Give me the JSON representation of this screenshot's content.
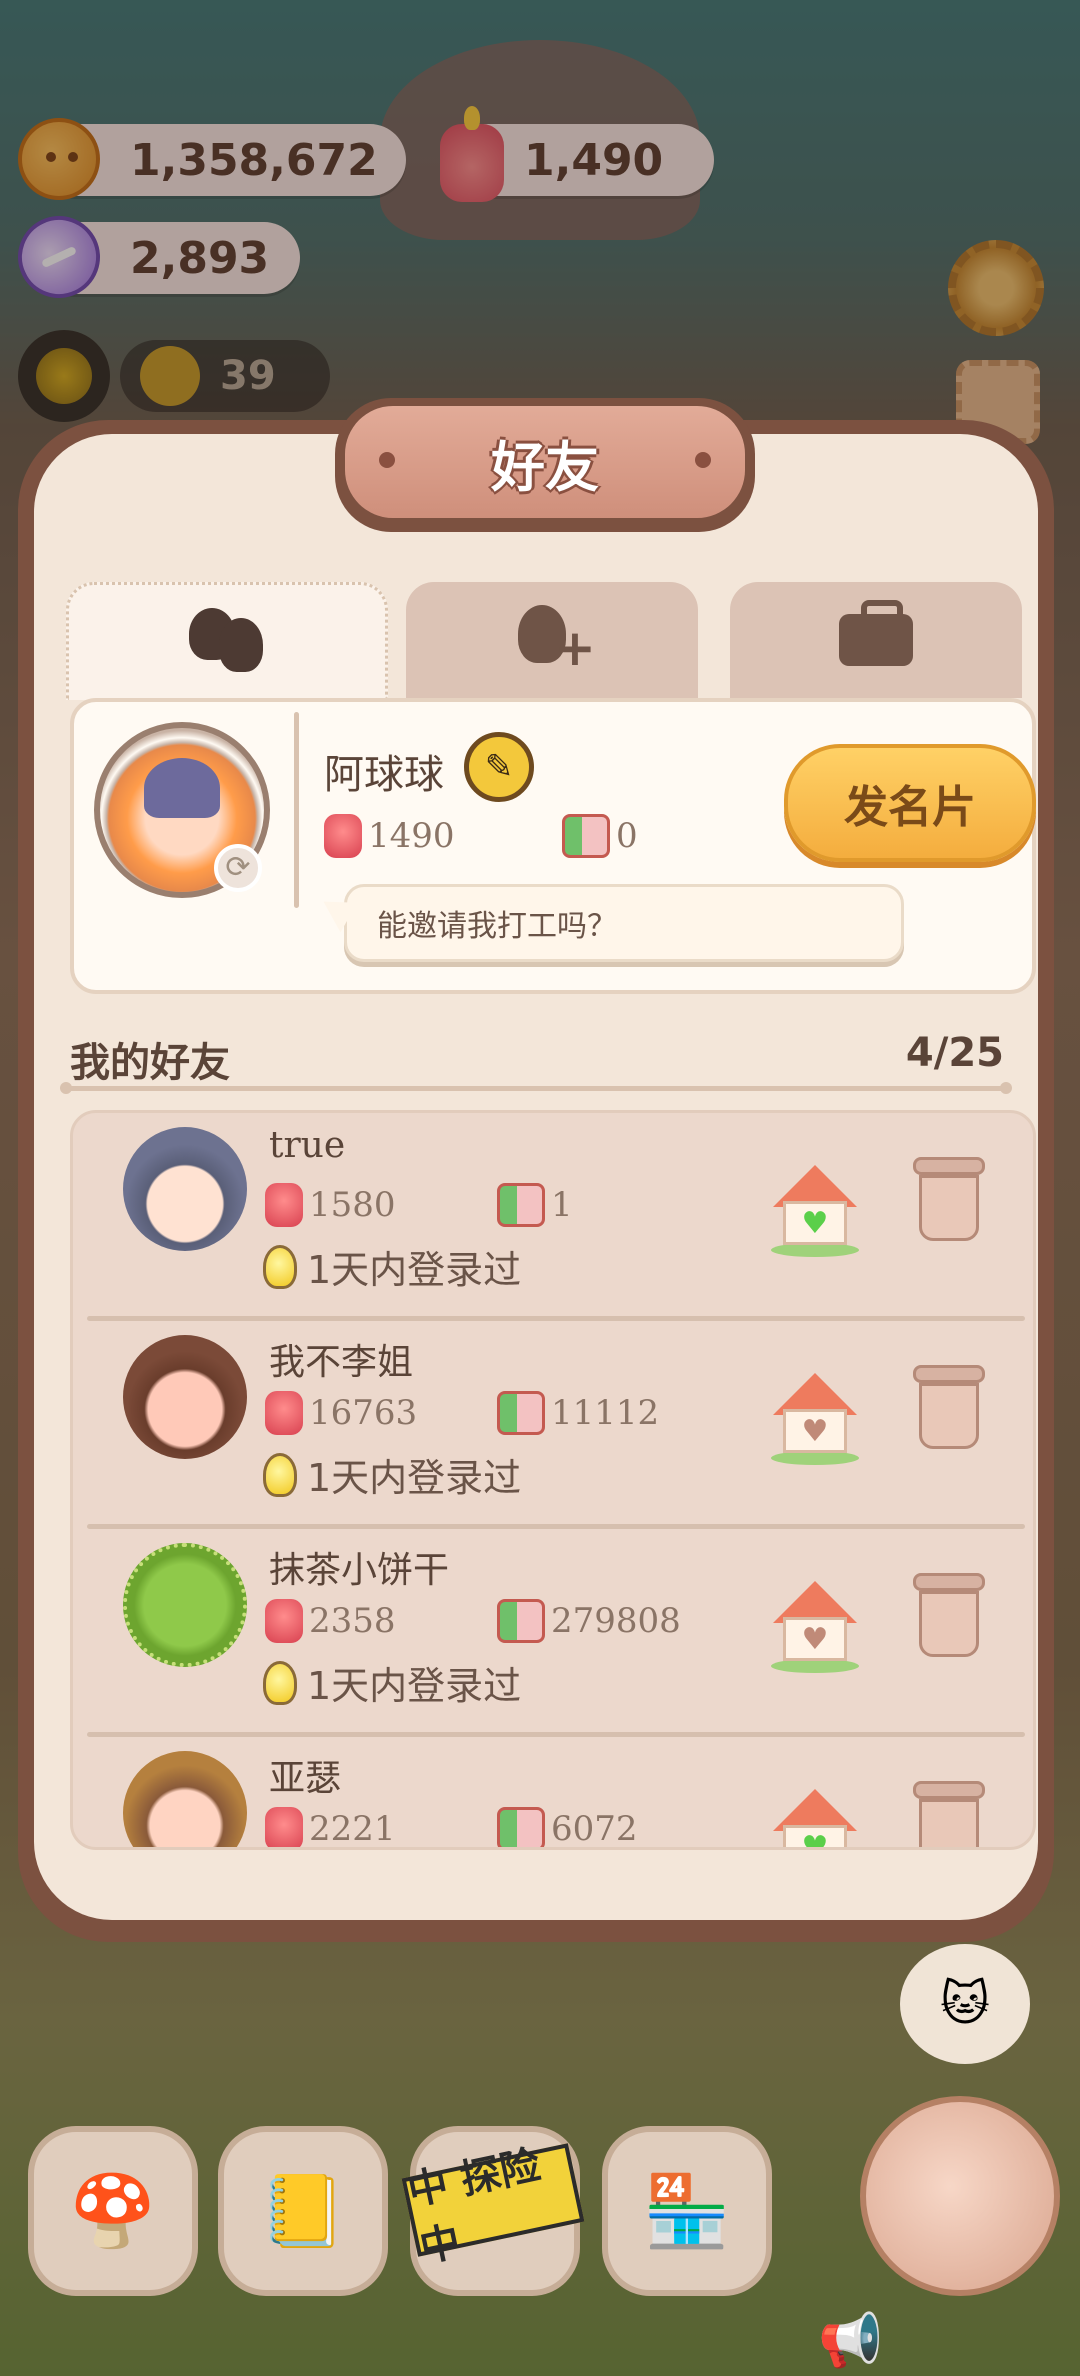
{
  "hud": {
    "cookies": "1,358,672",
    "candles": "1,490",
    "candy": "2,893",
    "level": "39"
  },
  "modal": {
    "title": "好友",
    "tabs": [
      {
        "name": "friends",
        "icon": "friends-icon"
      },
      {
        "name": "add-friend",
        "icon": "add-friend-icon"
      },
      {
        "name": "briefcase",
        "icon": "briefcase-icon"
      }
    ]
  },
  "profile": {
    "name": "阿球球",
    "candles": "1490",
    "cards": "0",
    "message": "能邀请我打工吗？",
    "card_button": "发名片"
  },
  "friends": {
    "title": "我的好友",
    "count": "4/25",
    "items": [
      {
        "name": "true",
        "candles": "1580",
        "cards": "1",
        "login": "1天内登录过"
      },
      {
        "name": "我不李姐",
        "candles": "16763",
        "cards": "11112",
        "login": "1天内登录过"
      },
      {
        "name": "抹茶小饼干",
        "candles": "2358",
        "cards": "279808",
        "login": "1天内登录过"
      },
      {
        "name": "亚瑟",
        "candles": "2221",
        "cards": "6072",
        "login": ""
      }
    ]
  },
  "bottom": {
    "explore_label": "中 探险中"
  },
  "colors": {
    "panel": "#f3e6d9",
    "frame": "#7c5140",
    "button": "#ffd166"
  }
}
